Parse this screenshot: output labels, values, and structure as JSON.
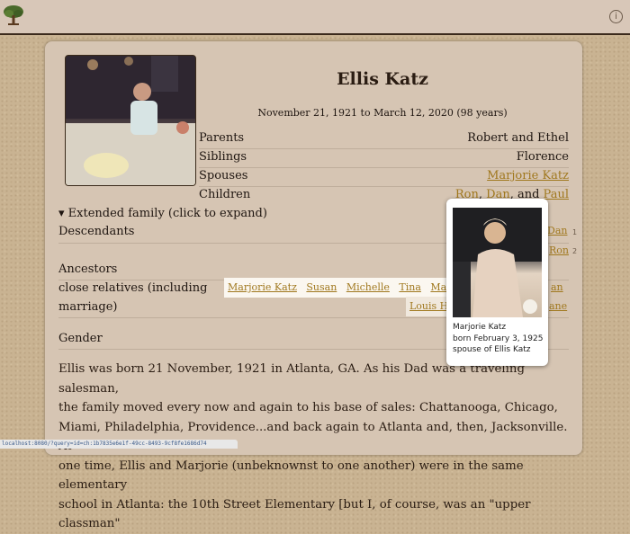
{
  "person": {
    "name": "Ellis Katz",
    "dates": "November 21, 1921 to March 12, 2020 (98 years)"
  },
  "facts": {
    "parents_label": "Parents",
    "parents_value": "Robert and Ethel",
    "siblings_label": "Siblings",
    "siblings_value": "Florence",
    "spouses_label": "Spouses",
    "spouses_value": "Marjorie Katz",
    "children_label": "Children",
    "children": [
      "Ron",
      "Dan",
      "Paul"
    ],
    "children_sep1": ", ",
    "children_sep2": ", and "
  },
  "extended": {
    "toggle": "▾ Extended family (click to expand)",
    "descendants_label": "Descendants",
    "descendants_links": [
      "Dan",
      "Ron"
    ],
    "descendants_nums": [
      "1",
      "2"
    ],
    "ancestors_label": "Ancestors",
    "close_label_line1": "close relatives (including",
    "close_label_line2": "marriage)",
    "close_row1": [
      "Marjorie Katz",
      "Susan",
      "Michelle",
      "Tina",
      "Margie S"
    ],
    "close_row1_tail": "an",
    "close_row2_head": "Louis H",
    "close_row2_tail": "ane",
    "gender_label": "Gender"
  },
  "bio": {
    "lines": [
      "Ellis was born 21 November, 1921 in Atlanta, GA. As his Dad was a traveling salesman,",
      "the family moved every now and again to his base of sales: Chattanooga, Chicago,",
      "Miami, Philadelphia, Providence...and back again to Atlanta and, then, Jacksonville. At",
      "one time, Ellis and Marjorie (unbeknownst to one another) were in the same elementary",
      "school in Atlanta: the 10th Street Elementary [but I, of course, was an \"upper classman\""
    ]
  },
  "popup": {
    "name": "Marjorie Katz",
    "born": "born February 3, 1925",
    "relation": "spouse of Ellis Katz"
  },
  "statusbar": {
    "url": "localhost:8080/?query=id=ch:1b7835e6e1f-49cc-8493-9cf8fe1686d74"
  },
  "colors": {
    "background": "#c9b392",
    "card": "#d6c5b3",
    "link": "#a0781e",
    "topbar": "#d8c7b8"
  },
  "icons": {
    "logo": "tree-icon",
    "info": "info-icon"
  }
}
